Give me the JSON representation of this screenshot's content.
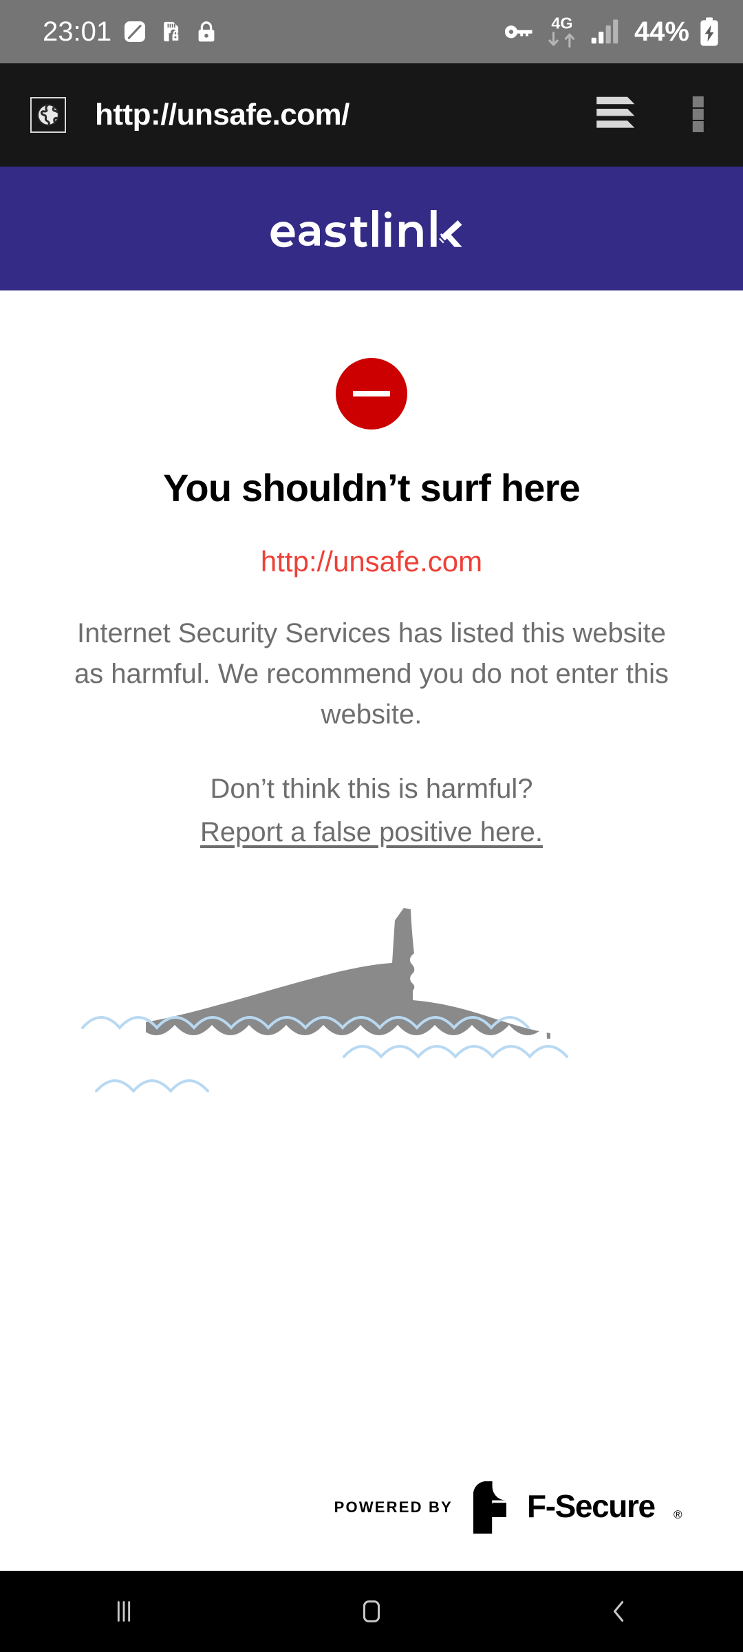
{
  "status_bar": {
    "time": "23:01",
    "battery_percent": "44%",
    "network_type": "4G",
    "icons": [
      "pen-slash-icon",
      "sd-card-lock-icon",
      "lock-icon",
      "vpn-key-icon",
      "data-transfer-icon",
      "signal-bars-icon",
      "battery-charging-icon"
    ],
    "background_color": "#757575",
    "foreground_color": "#ffffff"
  },
  "browser": {
    "url": "http://unsafe.com/",
    "favicon": "globe-icon",
    "tabs_icon": "tab-stack-icon",
    "menu_icon": "overflow-menu-icon",
    "background_color": "#171717"
  },
  "brand_banner": {
    "logo_text": "eastlink",
    "background_color": "#332B86",
    "text_color": "#ffffff"
  },
  "block_page": {
    "status_icon": "blocked-circle-icon",
    "status_icon_color": "#cc0000",
    "headline": "You shouldn’t surf here",
    "blocked_url": "http://unsafe.com",
    "blocked_url_color": "#ee4037",
    "description": "Internet Security Services has listed this website as harmful. We recommend you do not enter this website.",
    "prompt_question": "Don’t think this is harmful?",
    "report_link": "Report a false positive here.",
    "body_text_color": "#6e6e6e",
    "illustration": "shark-fin-in-water-illustration",
    "shark_color": "#8a8a8a",
    "wave_color": "#b9d9f2"
  },
  "footer": {
    "powered_by_label": "POWERED BY",
    "vendor_name": "F-Secure",
    "vendor_trademark": "®",
    "vendor_logo": "f-secure-logo-icon"
  },
  "nav_bar": {
    "background_color": "#000000",
    "buttons": [
      {
        "name": "recents",
        "icon": "recents-icon"
      },
      {
        "name": "home",
        "icon": "home-icon"
      },
      {
        "name": "back",
        "icon": "back-chevron-icon"
      }
    ]
  }
}
